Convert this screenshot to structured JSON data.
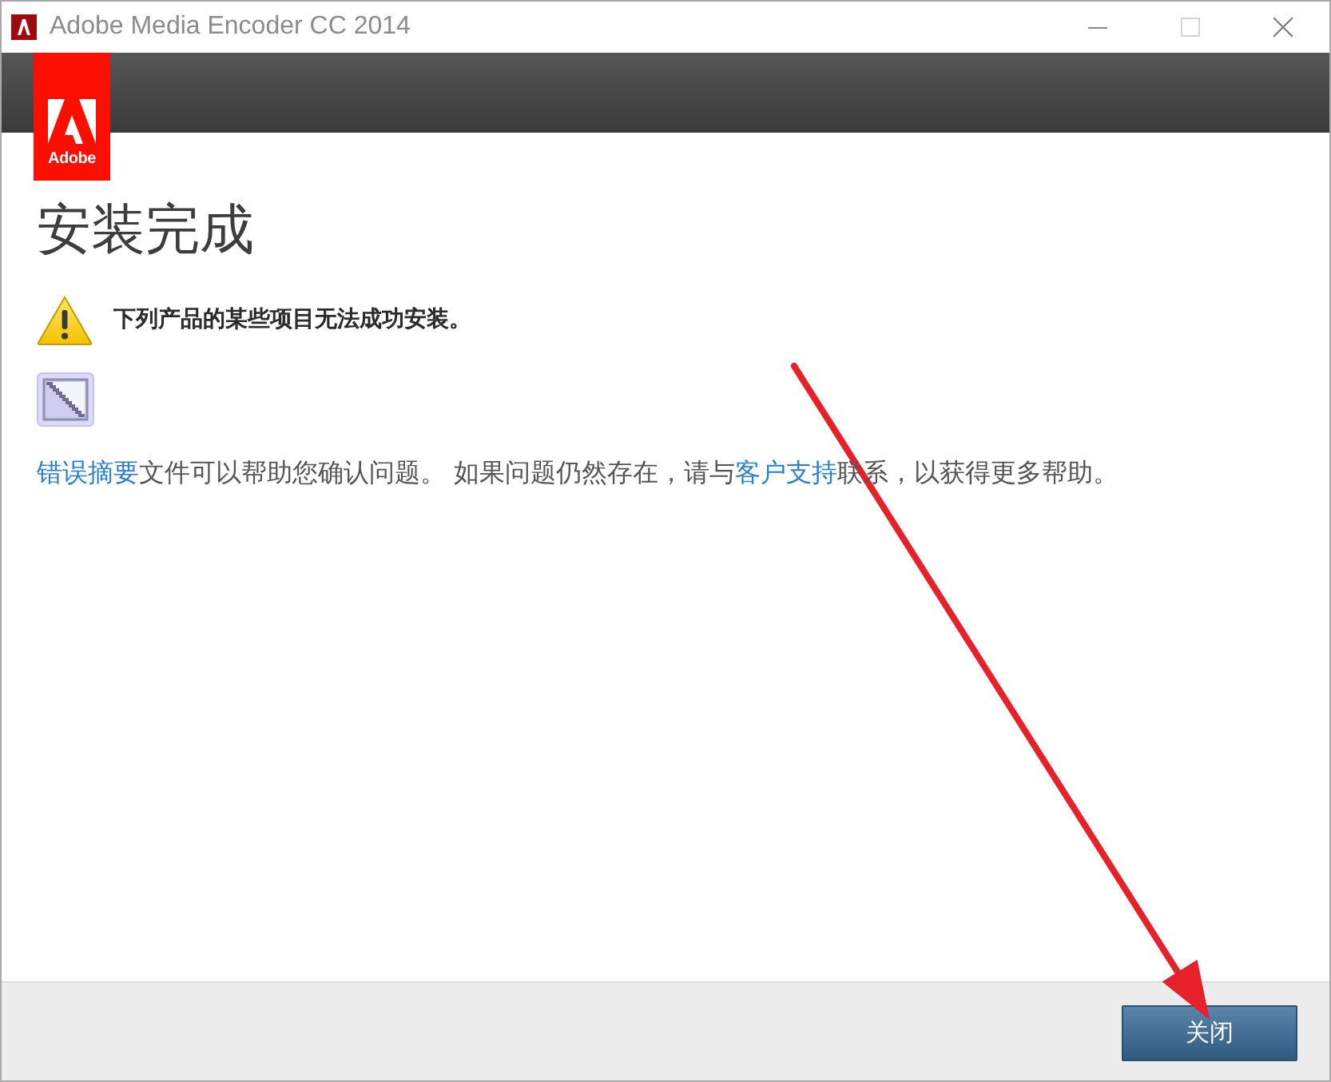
{
  "window": {
    "title": "Adobe Media Encoder CC 2014"
  },
  "header": {
    "logo_text": "Adobe"
  },
  "content": {
    "heading": "安装完成",
    "warning": {
      "message": "下列产品的某些项目无法成功安装。"
    },
    "help_text": [
      {
        "kind": "link",
        "text": "错误摘要"
      },
      {
        "kind": "text",
        "text": "文件可以帮助您确认问题。 如果问题仍然存在，请与"
      },
      {
        "kind": "link",
        "text": "客户支持"
      },
      {
        "kind": "text",
        "text": "联系，以获得更多帮助。"
      }
    ]
  },
  "buttons": [
    {
      "label": "关闭"
    }
  ]
}
